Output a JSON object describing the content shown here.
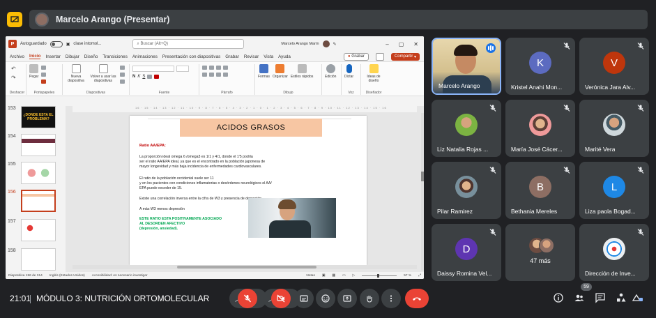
{
  "presenter": {
    "label": "Marcelo Arango (Presentar)"
  },
  "ppt": {
    "autosave_label": "Autoguardado",
    "file_name": "clase intomol...",
    "search_placeholder": "Buscar (Alt+Q)",
    "user_name": "Marcelo Arango Marín",
    "menu_items": [
      "Archivo",
      "Inicio",
      "Insertar",
      "Dibujar",
      "Diseño",
      "Transiciones",
      "Animaciones",
      "Presentación con diapositivas",
      "Grabar",
      "Revisar",
      "Vista",
      "Ayuda"
    ],
    "active_menu": "Inicio",
    "grabar_label": "Grabar",
    "share_label": "Compartir",
    "ribbon_groups": {
      "deshacer": "Deshacer",
      "portapapeles": "Portapapeles",
      "diapositivas": "Diapositivas",
      "fuente": "Fuente",
      "parrafo": "Párrafo",
      "dibujo": "Dibujo",
      "voz": "Voz",
      "disenador": "Diseñador"
    },
    "ribbon_buttons": {
      "pegar": "Pegar",
      "nueva_diapositiva": "Nueva diapositiva",
      "volver_usar": "Volver a usar las diapositivas",
      "formas": "Formas",
      "organizar": "Organizar",
      "estilos_rapidos": "Estilos rápidos",
      "edicion": "Edición",
      "dictar": "Dictar",
      "ideas_diseno": "Ideas de diseño"
    },
    "thumbnails": [
      {
        "num": "153",
        "caption": "¿DONDE ESTA EL PROBLEMA?",
        "selected": false
      },
      {
        "num": "154",
        "caption": "",
        "selected": false
      },
      {
        "num": "155",
        "caption": "",
        "selected": false
      },
      {
        "num": "156",
        "caption": "",
        "selected": true
      },
      {
        "num": "157",
        "caption": "",
        "selected": false
      },
      {
        "num": "158",
        "caption": "",
        "selected": false
      }
    ],
    "ruler_text": "16 · 15 · 14 · 13 · 12 · 11 · 10 · 9 · 8 · 7 · 6 · 5 · 4 · 3 · 2 · 1 · 0 · 1 · 2 · 3 · 4 · 5 · 6 · 7 · 8 · 9 · 10 · 11 · 12 · 13 · 14 · 15 · 16",
    "slide": {
      "title": "ACIDOS GRASOS",
      "subtitle": "Ratio AA/EPA:",
      "p1_l1": "La proporción ideal omega 6 /omega3 es 1/1  y 4/1, donde el 1'5 podría",
      "p1_l2": "ser el ratio AA/EPA ideal,  ya que es el encontrado en la población japonesa de",
      "p1_l3": "mayor longevidad y más baja incidencia de enfermedades cardiovasculares.",
      "p2_l1": "El ratio de la población occidental suele ser 11",
      "p2_l2": "y en los pacientes con condiciones inflamatorias o desórdenes neurológicos el AA/",
      "p2_l3": "EPA puede exceder de 15.",
      "p3": "Existe una correlación inversa entre la cifra de W3 y presencia de depresión.",
      "p4": "A más W3 menos depresión",
      "g1": "ESTE RATIO ESTA POSITIVAMENTE ASOCIADO",
      "g2": "AL DESORDEN AFECTIVO",
      "g3": "(depresión, ansiedad)."
    },
    "status": {
      "slide_info": "Diapositiva 156 de 314",
      "language": "Inglés (Estados Unidos)",
      "accessibility": "Accesibilidad: es necesario investigar",
      "notes": "Notas",
      "zoom": "57 %"
    }
  },
  "participants": [
    {
      "name": "Marcelo Arango",
      "type": "video",
      "speaking": true
    },
    {
      "name": "Kristel Anahi Mon...",
      "type": "letter",
      "letter": "K",
      "color": "#5c6bc0"
    },
    {
      "name": "Verónica Jara Alv...",
      "type": "letter",
      "letter": "V",
      "color": "#bf360c"
    },
    {
      "name": "Liz Natalia Rojas ...",
      "type": "photo",
      "color": "#7cb342"
    },
    {
      "name": "María José Cácer...",
      "type": "photo",
      "color": "#d4a373"
    },
    {
      "name": "Marité Vera",
      "type": "photo",
      "color": "#90a4ae"
    },
    {
      "name": "Pilar Ramirez",
      "type": "photo",
      "color": "#78909c"
    },
    {
      "name": "Bethania Mereles",
      "type": "letter",
      "letter": "B",
      "color": "#8d6e63"
    },
    {
      "name": "Liza paola Bogad...",
      "type": "letter",
      "letter": "L",
      "color": "#1e88e5"
    },
    {
      "name": "Daissy Romina Vel...",
      "type": "letter",
      "letter": "D",
      "color": "#5e35b1"
    },
    {
      "name": "47 más",
      "type": "more"
    },
    {
      "name": "Dirección de Inve...",
      "type": "photo",
      "color": "#eceff1"
    }
  ],
  "bottombar": {
    "time": "21:01",
    "meeting_title": "MÓDULO 3: NUTRICIÓN ORTOMOLECULAR",
    "participant_count": "59"
  },
  "colors": {
    "bg": "#202124",
    "tile": "#3c4043",
    "red": "#ea4335",
    "ppt_accent": "#c43e1c",
    "present_badge": "#fbbc04"
  }
}
